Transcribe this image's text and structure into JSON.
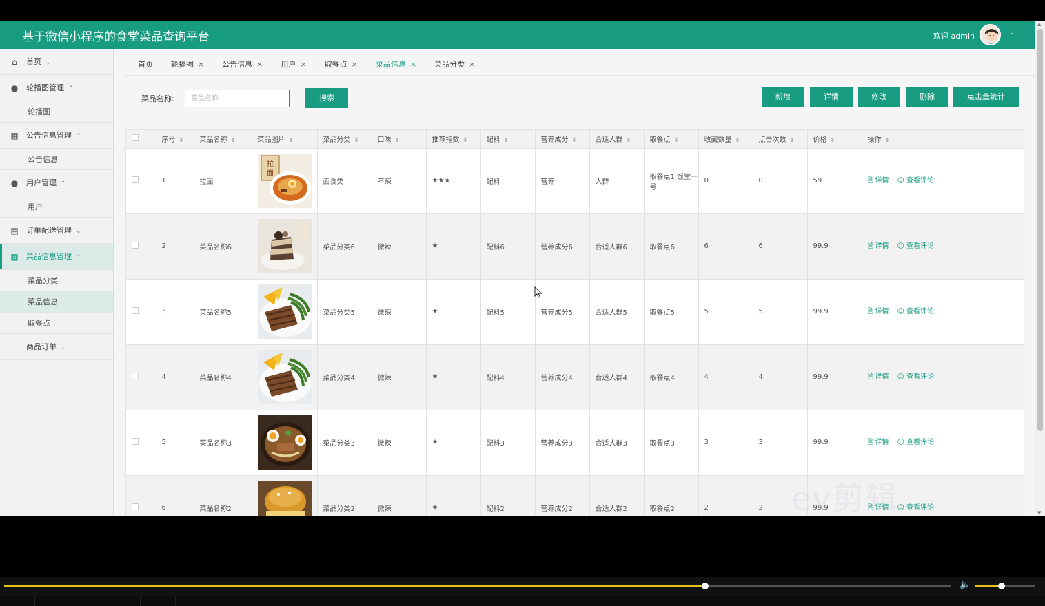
{
  "header": {
    "title": "基于微信小程序的食堂菜品查询平台",
    "welcome": "欢迎 admin",
    "dropdown_icon": "chevron-down-icon"
  },
  "sidebar": {
    "items": [
      {
        "label": "首页",
        "icon": "home-icon",
        "glyph": "⌂",
        "chev": "⌄"
      },
      {
        "label": "轮播图管理",
        "icon": "carousel-icon",
        "glyph": "●",
        "chev": "⌃",
        "sub": [
          "轮播图"
        ]
      },
      {
        "label": "公告信息管理",
        "icon": "grid-icon",
        "glyph": "▦",
        "chev": "⌃",
        "sub": [
          "公告信息"
        ]
      },
      {
        "label": "用户管理",
        "icon": "user-icon",
        "glyph": "●",
        "chev": "⌃",
        "sub": [
          "用户"
        ]
      },
      {
        "label": "订单配送管理",
        "icon": "server-icon",
        "glyph": "▤",
        "chev": "⌄"
      },
      {
        "label": "菜品信息管理",
        "icon": "grid-icon",
        "glyph": "▦",
        "chev": "⌃",
        "sub": [
          "菜品分类",
          "菜品信息",
          "取餐点"
        ]
      },
      {
        "label": "商品订单",
        "chev": "⌄"
      }
    ]
  },
  "tabs": [
    {
      "label": "首页",
      "closable": false
    },
    {
      "label": "轮播图",
      "closable": true
    },
    {
      "label": "公告信息",
      "closable": true
    },
    {
      "label": "用户",
      "closable": true
    },
    {
      "label": "取餐点",
      "closable": true
    },
    {
      "label": "菜品信息",
      "closable": true,
      "active": true
    },
    {
      "label": "菜品分类",
      "closable": true
    }
  ],
  "close_glyph": "×",
  "search": {
    "label": "菜品名称:",
    "placeholder": "菜品名称",
    "button": "搜索"
  },
  "actions": {
    "add": "新增",
    "detail": "详情",
    "edit": "修改",
    "delete": "删除",
    "stats": "点击量统计"
  },
  "table": {
    "columns": [
      "序号",
      "菜品名称",
      "菜品图片",
      "菜品分类",
      "口味",
      "推荐指数",
      "配料",
      "营养成分",
      "合适人群",
      "取餐点",
      "收藏数量",
      "点击次数",
      "价格",
      "操作"
    ],
    "sort_glyph": "⇕",
    "rows": [
      {
        "no": "1",
        "name": "拉面",
        "image": "ramen",
        "category": "面食类",
        "taste": "不辣",
        "rating": "★★★",
        "ingredients": "配料",
        "nutrition": "营养",
        "crowd": "人群",
        "pickup": "取餐点1,饭堂一号",
        "favorites": "0",
        "clicks": "0",
        "price": "59"
      },
      {
        "no": "2",
        "name": "菜品名称6",
        "image": "cake",
        "category": "菜品分类6",
        "taste": "微辣",
        "rating": "★",
        "ingredients": "配料6",
        "nutrition": "营养成分6",
        "crowd": "合适人群6",
        "pickup": "取餐点6",
        "favorites": "6",
        "clicks": "6",
        "price": "99.9"
      },
      {
        "no": "3",
        "name": "菜品名称5",
        "image": "steak",
        "category": "菜品分类5",
        "taste": "微辣",
        "rating": "★",
        "ingredients": "配料5",
        "nutrition": "营养成分5",
        "crowd": "合适人群5",
        "pickup": "取餐点5",
        "favorites": "5",
        "clicks": "5",
        "price": "99.9"
      },
      {
        "no": "4",
        "name": "菜品名称4",
        "image": "steak",
        "category": "菜品分类4",
        "taste": "微辣",
        "rating": "★",
        "ingredients": "配料4",
        "nutrition": "营养成分4",
        "crowd": "合适人群4",
        "pickup": "取餐点4",
        "favorites": "4",
        "clicks": "4",
        "price": "99.9"
      },
      {
        "no": "5",
        "name": "菜品名称3",
        "image": "ramen-bowl",
        "category": "菜品分类3",
        "taste": "微辣",
        "rating": "★",
        "ingredients": "配料3",
        "nutrition": "营养成分3",
        "crowd": "合适人群3",
        "pickup": "取餐点3",
        "favorites": "3",
        "clicks": "3",
        "price": "99.9"
      },
      {
        "no": "6",
        "name": "菜品名称2",
        "image": "burger",
        "category": "菜品分类2",
        "taste": "微辣",
        "rating": "★",
        "ingredients": "配料2",
        "nutrition": "营养成分2",
        "crowd": "合适人群2",
        "pickup": "取餐点2",
        "favorites": "2",
        "clicks": "2",
        "price": "99.9"
      }
    ],
    "row_actions": {
      "detail": "详情",
      "comments": "查看评论",
      "detail_icon": "document-icon",
      "comments_icon": "user-comment-icon"
    }
  },
  "player": {
    "progress": 0.74,
    "volume": 0.44,
    "volume_icon": "volume-icon"
  },
  "watermark": "ev剪辑",
  "colors": {
    "accent": "#179c82",
    "progress": "#e8c21a"
  }
}
